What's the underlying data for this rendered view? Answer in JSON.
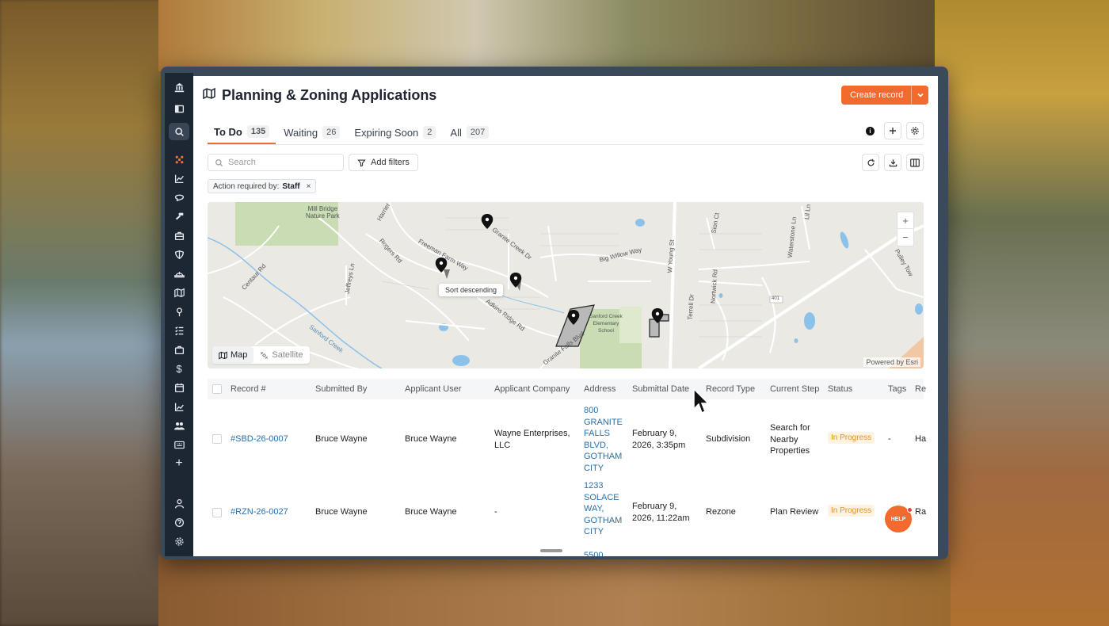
{
  "page": {
    "title": "Planning & Zoning Applications",
    "create_button": "Create record"
  },
  "tabs": [
    {
      "label": "To Do",
      "count": "135"
    },
    {
      "label": "Waiting",
      "count": "26"
    },
    {
      "label": "Expiring Soon",
      "count": "2"
    },
    {
      "label": "All",
      "count": "207"
    }
  ],
  "toolbar": {
    "search_placeholder": "Search",
    "add_filters": "Add filters",
    "chip_prefix": "Action required by:",
    "chip_value": "Staff",
    "chip_close": "×"
  },
  "map": {
    "mode_map": "Map",
    "mode_satellite": "Satellite",
    "attribution": "Powered by Esri",
    "zoom_in": "+",
    "zoom_out": "−",
    "labels": {
      "park": "Mill Bridge\nNature Park",
      "school": "Sanford Creek\nElementary\nSchool",
      "granite_creek": "Granite Creek Dr",
      "big_willow": "Big Willow Way",
      "freeman": "Freeman Farm Way",
      "rogers": "Rogers Rd",
      "jeffreys": "Jeffreys Ln",
      "centaur": "Centaur Rd",
      "adkins": "Adkins Ridge Rd",
      "granite_falls": "Granite Falls Blvd",
      "w_young": "W Young St",
      "terrell": "Terrell Dr",
      "nortwick": "Nortwick Rd",
      "waterstone": "Waterstone Ln",
      "sanford_creek": "Sanford Creek",
      "route": "401",
      "sion": "Sion Ct",
      "harrier": "Harrier",
      "lil": "Lil Ln",
      "pulley": "Pulley Tow"
    }
  },
  "tooltip": "Sort descending",
  "table": {
    "columns": [
      "Record #",
      "Submitted By",
      "Applicant User",
      "Applicant Company",
      "Address",
      "Submittal Date",
      "Record Type",
      "Current Step",
      "Status",
      "Tags",
      "Re"
    ],
    "rows": [
      {
        "record": "#SBD-26-0007",
        "submitted_by": "Bruce Wayne",
        "applicant_user": "Bruce Wayne",
        "applicant_company": "Wayne Enterprises,\nLLC",
        "address": "800\nGRANITE\nFALLS\nBLVD,\nGOTHAM\nCITY",
        "submittal_date": "February 9,\n2026, 3:35pm",
        "record_type": "Subdivision",
        "current_step": "Search for\nNearby\nProperties",
        "status": "In Progress",
        "tags": "-",
        "re": "Ha"
      },
      {
        "record": "#RZN-26-0027",
        "submitted_by": "Bruce Wayne",
        "applicant_user": "Bruce Wayne",
        "applicant_company": "-",
        "address": "1233\nSOLACE\nWAY,\nGOTHAM\nCITY",
        "submittal_date": "February 9,\n2026, 11:22am",
        "record_type": "Rezone",
        "current_step": "Plan Review",
        "status": "In Progress",
        "tags": "",
        "re": "Ra"
      }
    ],
    "partial_next_address": "5500"
  },
  "help": "HELP",
  "colors": {
    "accent": "#f26a2e",
    "sidebar": "#1d2633",
    "link": "#2a6fa8",
    "status_bg": "#fdf3e0",
    "status_fg": "#e0932a"
  }
}
